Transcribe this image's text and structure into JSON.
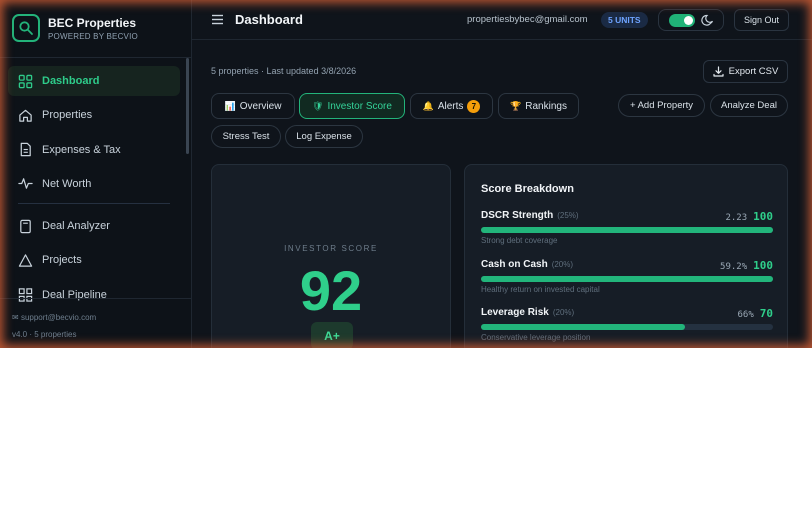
{
  "brand": {
    "name": "BEC Properties",
    "subtitle": "POWERED BY BECVIO"
  },
  "sidebar": {
    "items": [
      {
        "label": "Dashboard",
        "icon": "dashboard-grid-icon",
        "active": true
      },
      {
        "label": "Properties",
        "icon": "home-icon"
      },
      {
        "label": "Expenses & Tax",
        "icon": "document-icon"
      },
      {
        "label": "Net Worth",
        "icon": "pulse-icon"
      },
      {
        "label": "Deal Analyzer",
        "icon": "calculator-icon"
      },
      {
        "label": "Projects",
        "icon": "warning-triangle-icon"
      },
      {
        "label": "Deal Pipeline",
        "icon": "pipeline-icon"
      }
    ],
    "footer_email": "support@becvio.com",
    "footer_version": "v4.0 · 5 properties"
  },
  "topbar": {
    "title": "Dashboard",
    "email": "propertiesbybec@gmail.com",
    "units": "5 UNITS",
    "dark_mode": true,
    "signout": "Sign Out"
  },
  "main": {
    "status": "5 properties · Last updated 3/8/2026",
    "export_label": "Export CSV",
    "tabs": [
      {
        "label": "Overview",
        "icon": "📊"
      },
      {
        "label": "Investor Score",
        "icon": "🛡",
        "active": true
      },
      {
        "label": "Alerts",
        "icon": "🔔",
        "badge": "7"
      },
      {
        "label": "Rankings",
        "icon": "🏆"
      }
    ],
    "actions": {
      "add_property": "+ Add Property",
      "analyze_deal": "Analyze Deal"
    },
    "secondary": {
      "stress_test": "Stress Test",
      "log_expense": "Log Expense"
    }
  },
  "score": {
    "label": "INVESTOR SCORE",
    "value": "92",
    "grade": "A+"
  },
  "breakdown": {
    "title": "Score Breakdown",
    "metrics": [
      {
        "name": "DSCR Strength",
        "weight": "(25%)",
        "value": "2.23",
        "score": "100",
        "progress": 100,
        "desc": "Strong debt coverage"
      },
      {
        "name": "Cash on Cash",
        "weight": "(20%)",
        "value": "59.2%",
        "score": "100",
        "progress": 100,
        "desc": "Healthy return on invested capital"
      },
      {
        "name": "Leverage Risk",
        "weight": "(20%)",
        "value": "66%",
        "score": "70",
        "progress": 70,
        "desc": "Conservative leverage position"
      }
    ]
  },
  "colors": {
    "accent": "#2fcf8b",
    "background": "#0f141b",
    "badge": "#f59e0b",
    "units": "#6ea3ff"
  }
}
